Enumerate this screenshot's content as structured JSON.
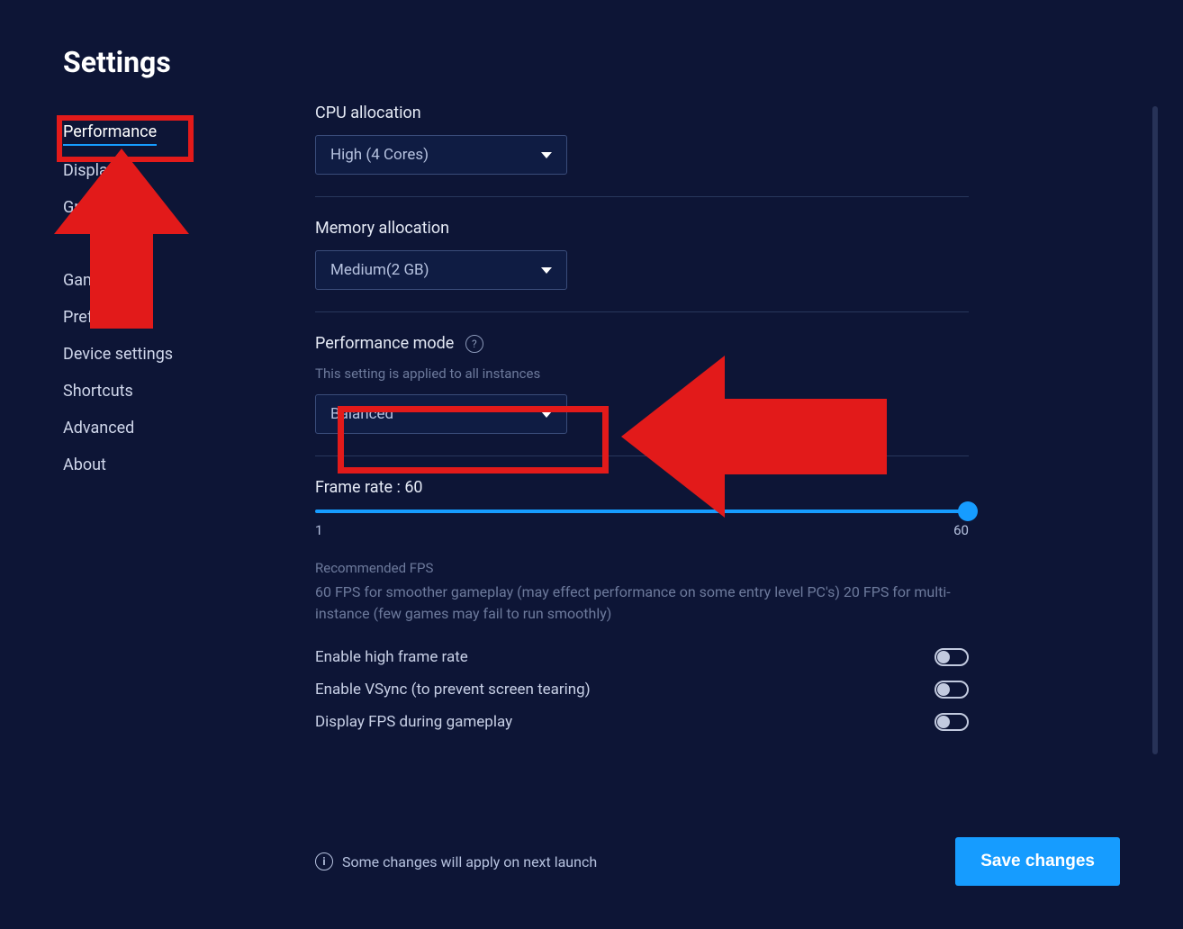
{
  "page_title": "Settings",
  "sidebar": {
    "items": [
      {
        "label": "Performance",
        "active": true
      },
      {
        "label": "Display"
      },
      {
        "label": "Graphics"
      },
      {
        "label": "Gamepad"
      },
      {
        "label": "Preferences"
      },
      {
        "label": "Device settings"
      },
      {
        "label": "Shortcuts"
      },
      {
        "label": "Advanced"
      },
      {
        "label": "About"
      }
    ]
  },
  "cpu": {
    "label": "CPU allocation",
    "value": "High (4 Cores)"
  },
  "memory": {
    "label": "Memory allocation",
    "value": "Medium(2 GB)"
  },
  "perf_mode": {
    "label": "Performance mode",
    "sub": "This setting is applied to all instances",
    "value": "Balanced"
  },
  "frame_rate": {
    "label": "Frame rate : 60",
    "min": "1",
    "max": "60",
    "value": 60
  },
  "rec_fps": {
    "label": "Recommended FPS",
    "text": "60 FPS for smoother gameplay (may effect performance on some entry level PC's) 20 FPS for multi-instance (few games may fail to run smoothly)"
  },
  "toggles": {
    "high_frame": "Enable high frame rate",
    "vsync": "Enable VSync (to prevent screen tearing)",
    "display_fps": "Display FPS during gameplay"
  },
  "footer": {
    "note": "Some changes will apply on next launch",
    "save": "Save changes"
  }
}
